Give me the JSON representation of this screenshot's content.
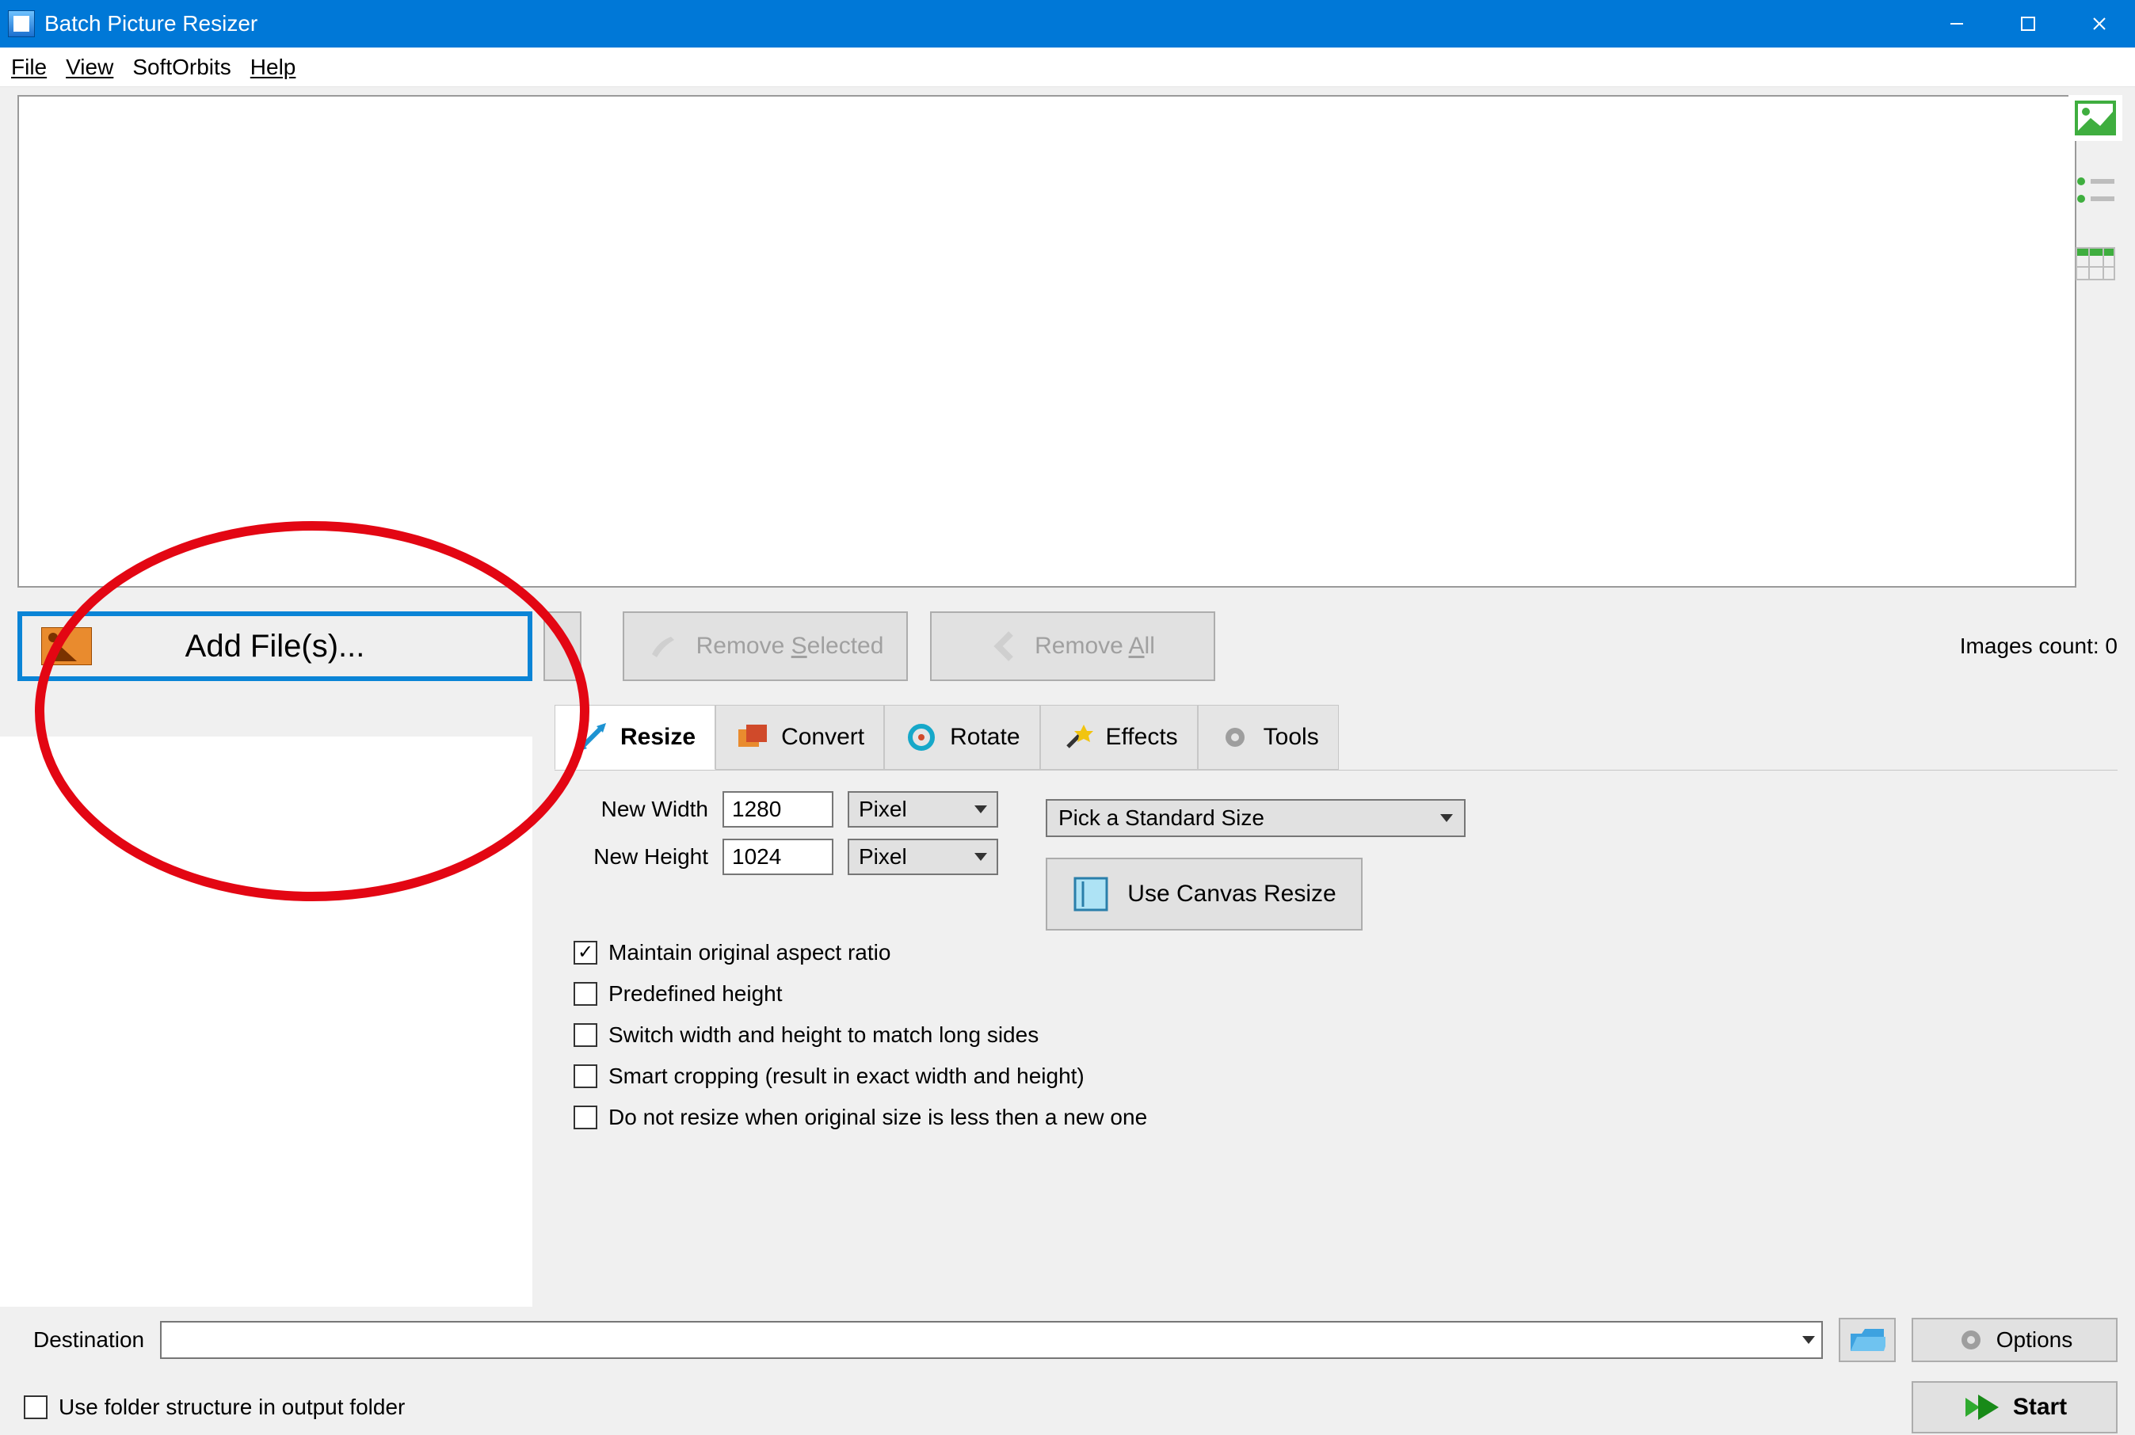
{
  "titlebar": {
    "title": "Batch Picture Resizer"
  },
  "menu": {
    "file": "File",
    "view": "View",
    "softorbits": "SoftOrbits",
    "help": "Help"
  },
  "toolbar": {
    "add_files": "Add File(s)...",
    "remove_selected": "Remove Selected",
    "remove_all": "Remove All",
    "count_label": "Images count: 0"
  },
  "tabs": {
    "resize": "Resize",
    "convert": "Convert",
    "rotate": "Rotate",
    "effects": "Effects",
    "tools": "Tools"
  },
  "resize": {
    "width_label": "New Width",
    "width_value": "1280",
    "width_unit": "Pixel",
    "height_label": "New Height",
    "height_value": "1024",
    "height_unit": "Pixel",
    "standard_size": "Pick a Standard Size",
    "canvas_btn": "Use Canvas Resize",
    "cb_aspect": "Maintain original aspect ratio",
    "cb_predef": "Predefined height",
    "cb_switch": "Switch width and height to match long sides",
    "cb_smart": "Smart cropping (result in exact width and height)",
    "cb_noresize": "Do not resize when original size is less then a new one"
  },
  "bottom": {
    "dest_label": "Destination",
    "options": "Options",
    "folder_struct": "Use folder structure in output folder",
    "start": "Start"
  }
}
